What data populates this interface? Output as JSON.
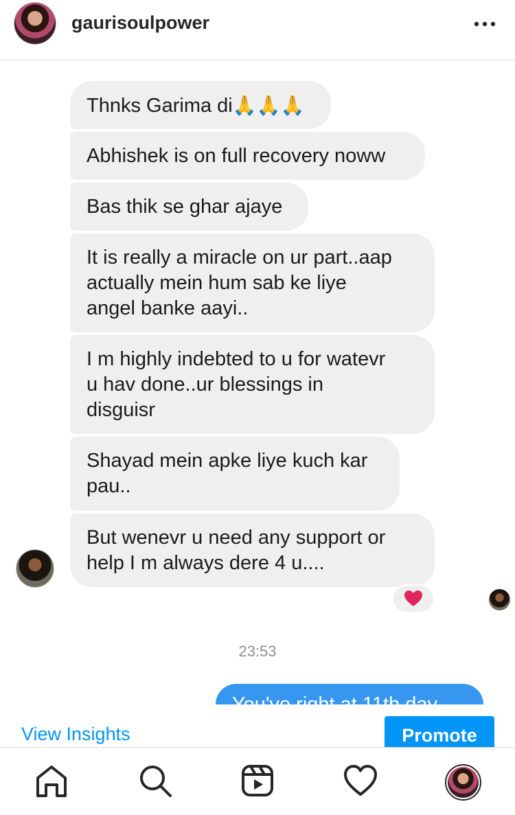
{
  "header": {
    "username": "gaurisoulpower",
    "more_icon": "more-horizontal-icon"
  },
  "messages": [
    {
      "text": "Thnks Garima di",
      "emoji": "🙏🙏🙏"
    },
    {
      "text": "Abhishek is on full recovery noww"
    },
    {
      "text": "Bas thik se ghar ajaye"
    },
    {
      "lines": [
        "It is really a miracle on ur part..aap",
        "actually mein hum sab ke liye",
        "angel banke aayi.."
      ]
    },
    {
      "lines": [
        "I m highly indebted to u for watevr",
        "u hav done..ur blessings in",
        "disguisr"
      ]
    },
    {
      "lines": [
        "Shayad mein apke liye kuch kar",
        "pau.."
      ]
    },
    {
      "lines": [
        "But wenevr u need any support or",
        "help I m always dere 4 u...."
      ]
    }
  ],
  "reaction": "❤",
  "timestamp": "23:53",
  "outgoing_message": "You've right at 11th day...",
  "insights": {
    "view_label": "View Insights",
    "promote_label": "Promote"
  },
  "nav": {
    "items": [
      "home-icon",
      "search-icon",
      "reels-icon",
      "heart-icon",
      "profile-avatar"
    ]
  },
  "colors": {
    "accent": "#0095f6",
    "bubble_in": "#efefef",
    "bubble_out": "#3797f0",
    "reaction_heart": "#e0245e"
  }
}
